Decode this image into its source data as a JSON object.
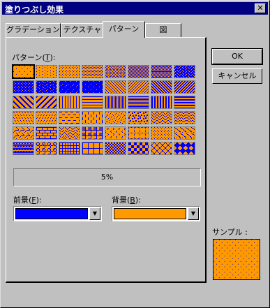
{
  "window": {
    "title": "塗りつぶし効果",
    "close_label": "✕"
  },
  "tabs": [
    {
      "label": "グラデーション",
      "active": false
    },
    {
      "label": "テクスチャ",
      "active": false
    },
    {
      "label": "パターン",
      "active": true
    },
    {
      "label": "図",
      "active": false
    }
  ],
  "pattern_section": {
    "label_prefix": "パターン(",
    "accesskey": "T",
    "label_suffix": "):"
  },
  "selected_pattern_name": "5%",
  "foreground": {
    "label_prefix": "前景(",
    "accesskey": "F",
    "label_suffix": "):",
    "color": "#0000ff"
  },
  "background": {
    "label_prefix": "背景(",
    "accesskey": "B",
    "label_suffix": "):",
    "color": "#ff9900"
  },
  "buttons": {
    "ok": "OK",
    "cancel": "キャンセル"
  },
  "sample": {
    "label": "サンプル :"
  },
  "colors": {
    "title_bar": "#000080",
    "dialog_face": "#c0c0c0",
    "fg": "#0000ff",
    "bg": "#ff9900"
  },
  "patterns": [
    "percent-5",
    "percent-10",
    "percent-20",
    "percent-25",
    "percent-30",
    "percent-40",
    "percent-50",
    "percent-60",
    "percent-70",
    "percent-75",
    "percent-80",
    "percent-90",
    "light-downward-diagonal",
    "light-upward-diagonal",
    "dark-downward-diagonal",
    "dark-upward-diagonal",
    "wide-downward-diagonal",
    "wide-upward-diagonal",
    "light-vertical",
    "light-horizontal",
    "narrow-vertical",
    "narrow-horizontal",
    "dark-vertical",
    "dark-horizontal",
    "dashed-downward-diagonal",
    "dashed-upward-diagonal",
    "dashed-horizontal",
    "dashed-vertical",
    "small-confetti",
    "large-confetti",
    "zig-zag",
    "wave",
    "diagonal-brick",
    "horizontal-brick",
    "weave",
    "plaid",
    "divot",
    "dotted-grid",
    "dotted-diamond",
    "shingle",
    "trellis",
    "sphere",
    "small-grid",
    "large-grid",
    "small-checkerboard",
    "large-checkerboard",
    "outlined-diamond",
    "solid-diamond"
  ],
  "selected_index": 0
}
